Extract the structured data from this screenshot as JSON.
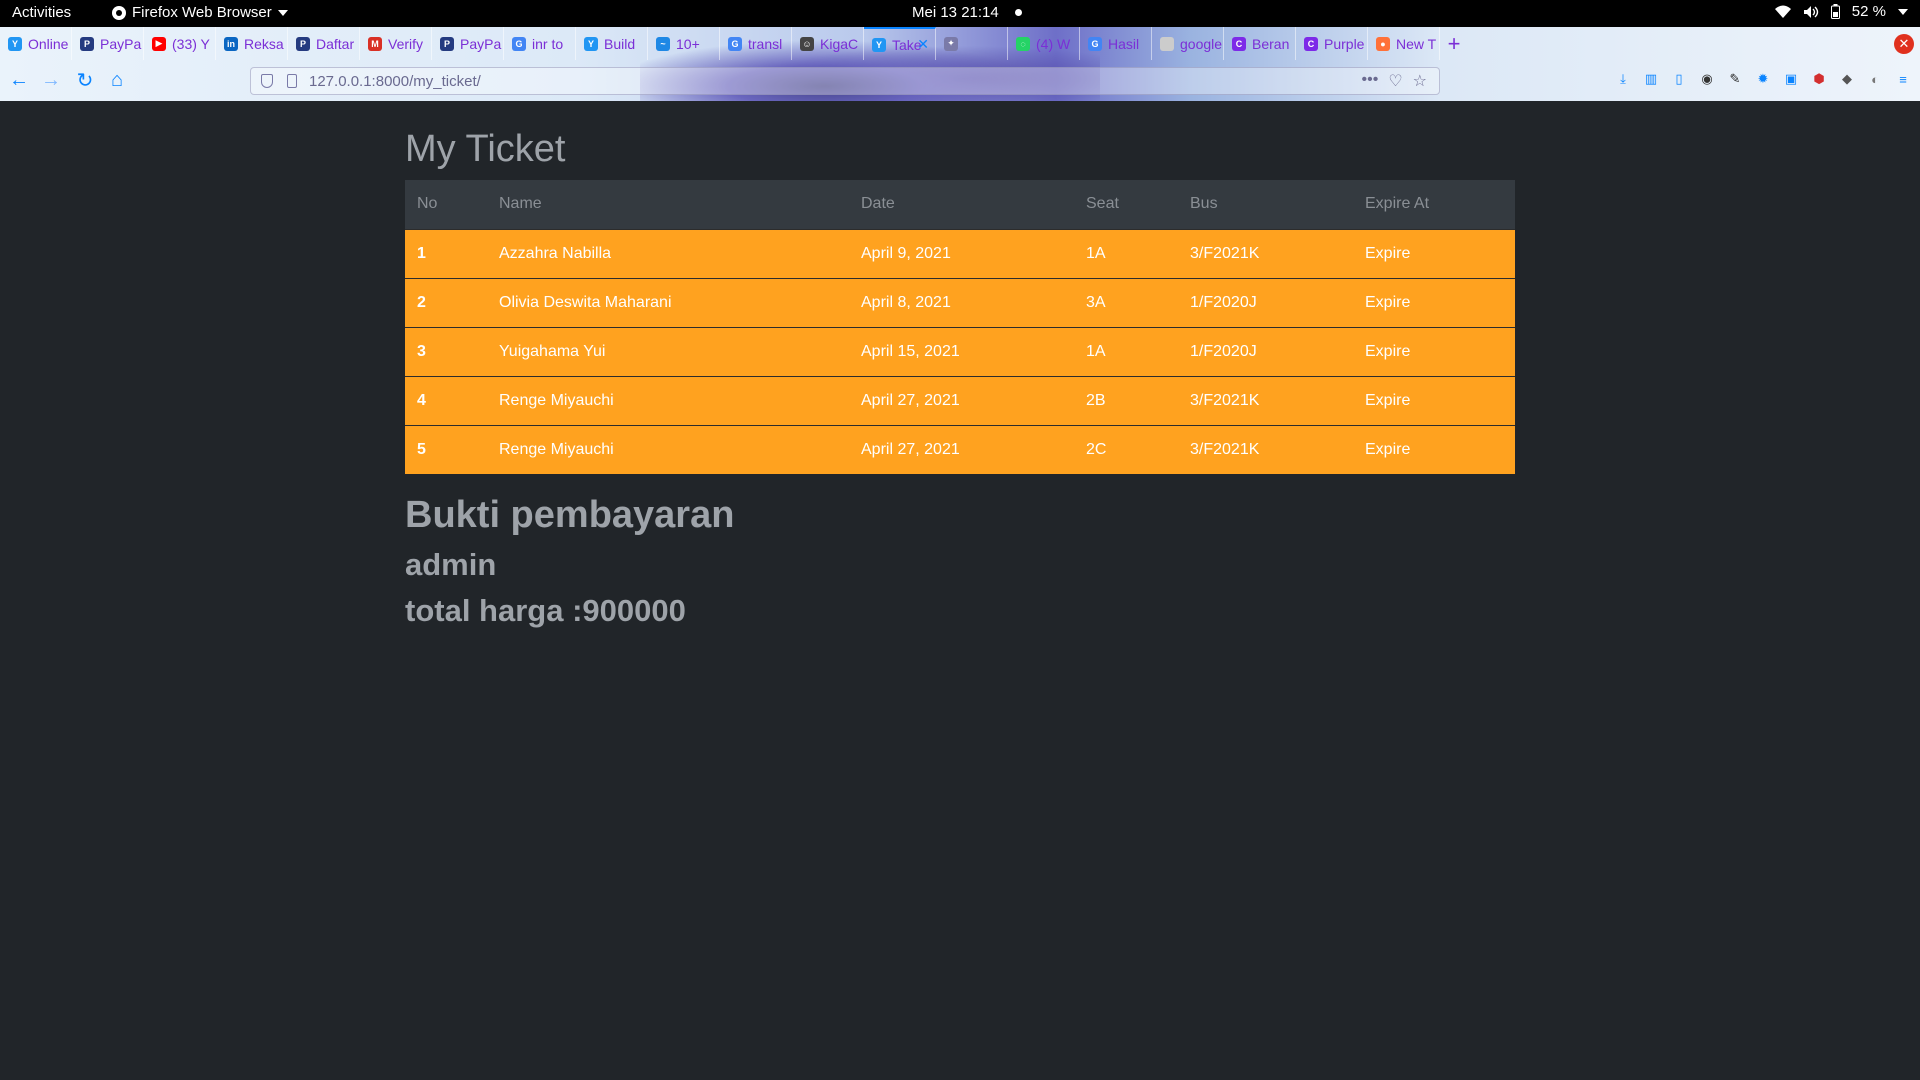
{
  "system_bar": {
    "activities": "Activities",
    "app_name": "Firefox Web Browser",
    "clock": "Mei 13  21:14",
    "battery": "52 %"
  },
  "browser": {
    "tabs": [
      {
        "label": "Online",
        "icon": "yandex-icon",
        "color": "#2196f3"
      },
      {
        "label": "PayPa",
        "icon": "paypal-icon",
        "color": "#253b80"
      },
      {
        "label": "(33) Y",
        "icon": "youtube-icon",
        "color": "#ff0000"
      },
      {
        "label": "Reksa",
        "icon": "linkedin-icon",
        "color": "#0a66c2"
      },
      {
        "label": "Daftar",
        "icon": "paypal-icon",
        "color": "#253b80"
      },
      {
        "label": "Verify",
        "icon": "gmail-icon",
        "color": "#d93025"
      },
      {
        "label": "PayPa",
        "icon": "paypal-icon",
        "color": "#253b80"
      },
      {
        "label": "inr to",
        "icon": "google-icon",
        "color": "#4285f4"
      },
      {
        "label": "Build",
        "icon": "yandex-icon",
        "color": "#2196f3"
      },
      {
        "label": "10+",
        "icon": "chart-icon",
        "color": "#1e88e5"
      },
      {
        "label": "transl",
        "icon": "google-icon",
        "color": "#4285f4"
      },
      {
        "label": "KigaC",
        "icon": "avatar-icon",
        "color": "#444444"
      },
      {
        "label": "Take",
        "icon": "yandex-icon",
        "color": "#2196f3"
      },
      {
        "label": "",
        "icon": "puzzle-icon",
        "color": "#7a7aa8"
      },
      {
        "label": "(4) W",
        "icon": "whatsapp-icon",
        "color": "#25d366"
      },
      {
        "label": "Hasil",
        "icon": "google-icon",
        "color": "#4285f4"
      },
      {
        "label": "google.c",
        "icon": "blank-icon",
        "color": "#cccccc"
      },
      {
        "label": "Beran",
        "icon": "canva-icon",
        "color": "#7d2ae8"
      },
      {
        "label": "Purple",
        "icon": "canva-icon",
        "color": "#7d2ae8"
      },
      {
        "label": "New T",
        "icon": "firefox-icon",
        "color": "#ff7139"
      }
    ],
    "active_tab_index": 12,
    "url": "127.0.0.1:8000/my_ticket/"
  },
  "page": {
    "title": "My Ticket",
    "table": {
      "headers": [
        "No",
        "Name",
        "Date",
        "Seat",
        "Bus",
        "Expire At"
      ],
      "rows": [
        [
          "1",
          "Azzahra Nabilla",
          "April 9, 2021",
          "1A",
          "3/F2021K",
          "Expire"
        ],
        [
          "2",
          "Olivia Deswita Maharani",
          "April 8, 2021",
          "3A",
          "1/F2020J",
          "Expire"
        ],
        [
          "3",
          "Yuigahama Yui",
          "April 15, 2021",
          "1A",
          "1/F2020J",
          "Expire"
        ],
        [
          "4",
          "Renge Miyauchi",
          "April 27, 2021",
          "2B",
          "3/F2021K",
          "Expire"
        ],
        [
          "5",
          "Renge Miyauchi",
          "April 27, 2021",
          "2C",
          "3/F2021K",
          "Expire"
        ]
      ],
      "row_color": "#ffa21f",
      "header_color": "#343a40"
    },
    "payment_heading": "Bukti pembayaran",
    "user": "admin",
    "total": "total harga :900000"
  },
  "colors": {
    "background": "#212529",
    "muted_text": "#9ea3a9",
    "accent": "#0a84ff"
  }
}
